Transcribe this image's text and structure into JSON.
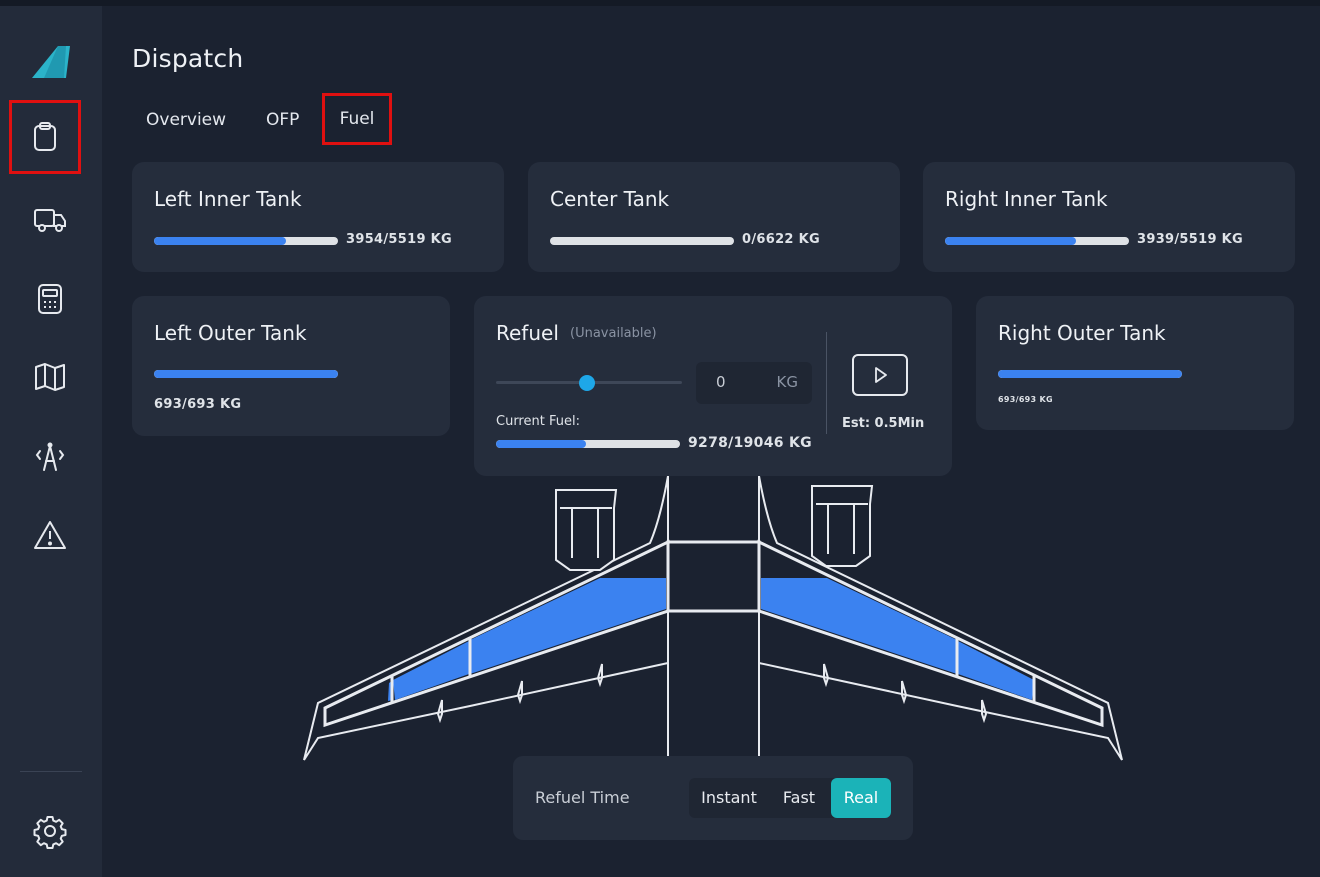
{
  "header": {
    "title": "Dispatch"
  },
  "tabs": [
    {
      "label": "Overview"
    },
    {
      "label": "OFP"
    },
    {
      "label": "Fuel"
    }
  ],
  "tanks": {
    "left_inner": {
      "title": "Left Inner Tank",
      "value": "3954/5519 KG",
      "fraction": 0.716
    },
    "center": {
      "title": "Center Tank",
      "value": "0/6622 KG",
      "fraction": 0.0
    },
    "right_inner": {
      "title": "Right Inner Tank",
      "value": "3939/5519 KG",
      "fraction": 0.714
    },
    "left_outer": {
      "title": "Left Outer Tank",
      "value": "693/693 KG",
      "fraction": 1.0
    },
    "right_outer": {
      "title": "Right Outer Tank",
      "value": "693/693 KG",
      "fraction": 1.0
    }
  },
  "refuel": {
    "title": "Refuel",
    "status": "(Unavailable)",
    "amount": "0",
    "unit": "KG",
    "current_fuel_label": "Current Fuel:",
    "current_fuel_value": "9278/19046 KG",
    "current_fraction": 0.487,
    "estimate": "Est: 0.5Min"
  },
  "refuel_time": {
    "label": "Refuel Time",
    "options": [
      "Instant",
      "Fast",
      "Real"
    ],
    "selected": "Real"
  },
  "colors": {
    "accent": "#1bb3b8",
    "fuel": "#3b82f0",
    "highlight": "#e01010",
    "slider": "#1ea7e8"
  },
  "icons": [
    "logo-icon",
    "clipboard-icon",
    "truck-icon",
    "calculator-icon",
    "map-icon",
    "tower-icon",
    "warning-icon",
    "gear-icon",
    "play-icon"
  ]
}
